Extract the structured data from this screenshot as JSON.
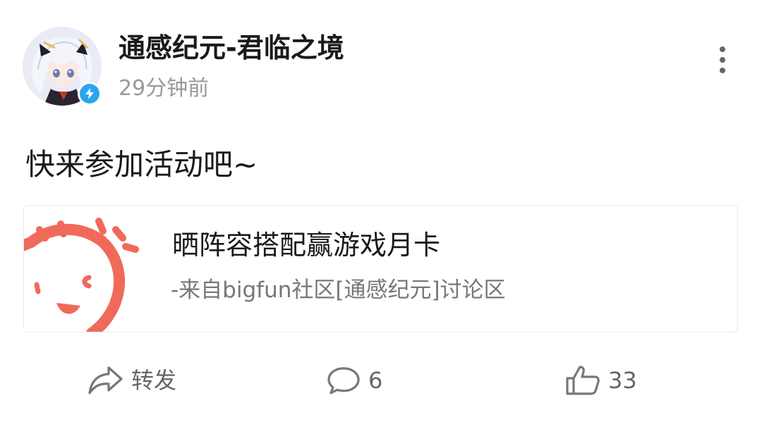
{
  "post": {
    "author": {
      "name": "通感纪元-君临之境",
      "time": "29分钟前",
      "avatar_icon": "anime-character-avatar",
      "verified_icon": "lightning-verified-icon",
      "verified_color": "#2BA4F0"
    },
    "content_text": "快来参加活动吧~",
    "link_card": {
      "thumb_icon": "bigfun-smile-logo",
      "thumb_color": "#F06A5A",
      "title": "晒阵容搭配赢游戏月卡",
      "source": "-来自bigfun社区[通感纪元]讨论区"
    },
    "actions": {
      "share_label": "转发",
      "comment_count": "6",
      "like_count": "33"
    }
  }
}
